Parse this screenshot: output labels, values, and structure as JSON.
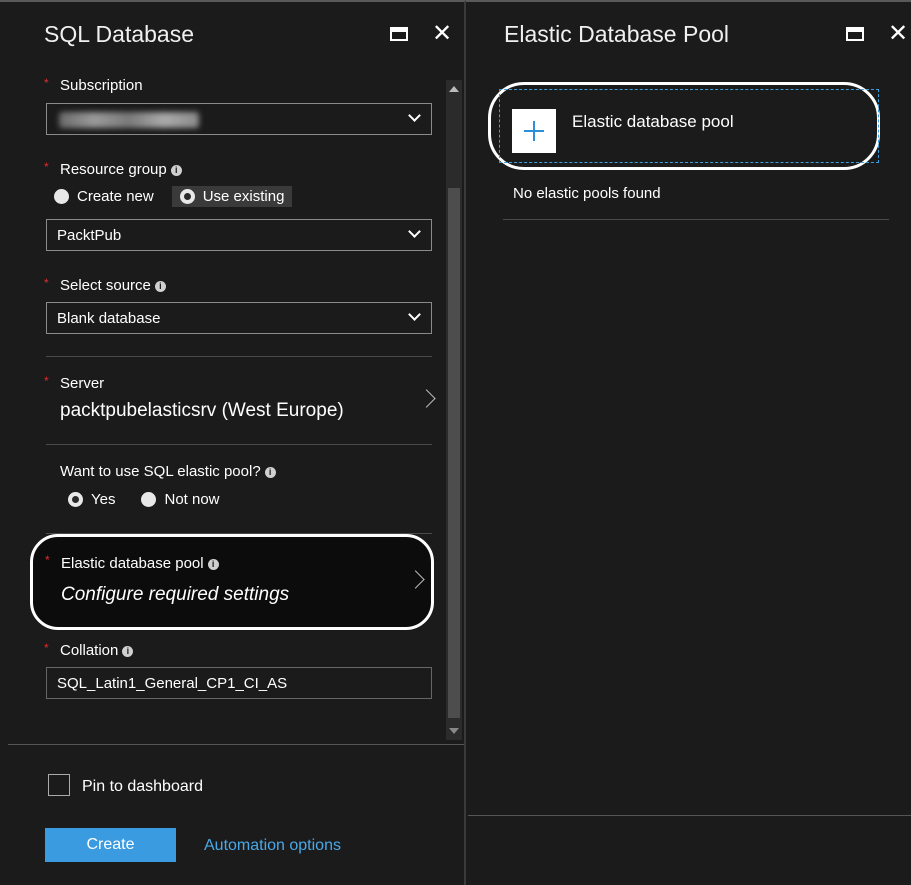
{
  "sql_blade": {
    "title": "SQL Database",
    "subscription": {
      "label": "Subscription"
    },
    "resource_group": {
      "label": "Resource group",
      "options": [
        "Create new",
        "Use existing"
      ],
      "selected": "Use existing",
      "value": "PacktPub"
    },
    "source": {
      "label": "Select source",
      "value": "Blank database"
    },
    "server": {
      "label": "Server",
      "value": "packtpubelasticsrv (West Europe)"
    },
    "elastic_pool_question": {
      "label": "Want to use SQL elastic pool?",
      "options": [
        "Yes",
        "Not now"
      ],
      "selected": "Yes"
    },
    "elastic_pool": {
      "label": "Elastic database pool",
      "value": "Configure required settings"
    },
    "collation": {
      "label": "Collation",
      "value": "SQL_Latin1_General_CP1_CI_AS"
    },
    "footer": {
      "pin_label": "Pin to dashboard",
      "create_label": "Create",
      "automation_label": "Automation options"
    }
  },
  "pool_blade": {
    "title": "Elastic Database Pool",
    "add_label": "Elastic database pool",
    "empty_message": "No elastic pools found"
  },
  "colors": {
    "background": "#1b1b1b",
    "required": "#e62b2b",
    "accent": "#3b9be0",
    "link": "#4aa8e8"
  }
}
